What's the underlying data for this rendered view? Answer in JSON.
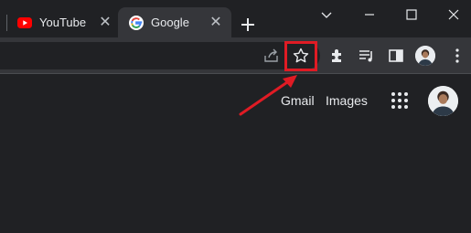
{
  "tabs": [
    {
      "label": "YouTube",
      "favicon": "youtube-icon",
      "active": false
    },
    {
      "label": "Google",
      "favicon": "google-g-icon",
      "active": true
    }
  ],
  "tab_close_glyph": "✕",
  "window_controls": [
    "chevron-down-icon",
    "minimize-icon",
    "maximize-icon",
    "close-icon"
  ],
  "toolbar": {
    "icons": [
      "share-icon",
      "bookmark-star-icon",
      "extensions-puzzle-icon",
      "media-control-icon",
      "side-panel-icon",
      "profile-avatar",
      "menu-dots-icon"
    ],
    "highlighted": "bookmark-star-icon",
    "highlight_color": "#e01b24"
  },
  "header_links": {
    "gmail": "Gmail",
    "images": "Images"
  },
  "header_icons": [
    "apps-grid-icon",
    "account-avatar"
  ],
  "annotation": {
    "type": "red-arrow",
    "color": "#e01b24"
  }
}
